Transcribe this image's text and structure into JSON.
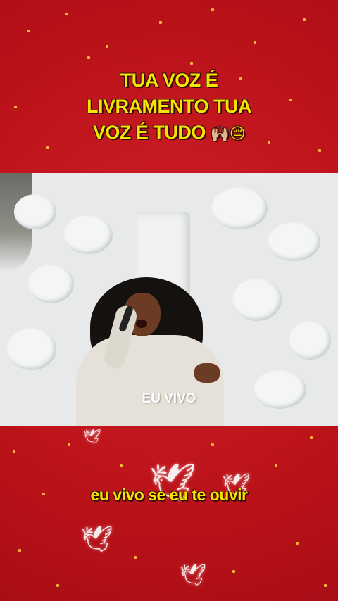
{
  "headline": {
    "line1": "TUA VOZ É",
    "line2": "LIVRAMENTO TUA",
    "line3": "VOZ É TUDO",
    "emojis": "🙌🏼😔"
  },
  "video": {
    "caption": "EU VIVO"
  },
  "lyric": {
    "text": "eu vivo se eu te ouvir"
  },
  "decor": {
    "angel_icon": "dove-icon"
  },
  "colors": {
    "background": "#c2161f",
    "headline_text": "#f4e500",
    "confetti": "#f3b534"
  }
}
